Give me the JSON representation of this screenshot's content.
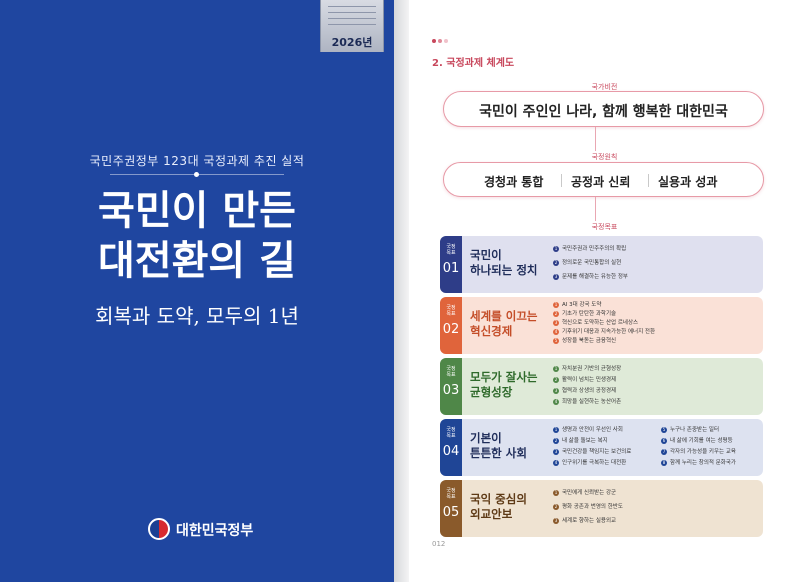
{
  "cover": {
    "year": "2026년",
    "subtitle": "국민주권정부 123대 국정과제 추진 실적",
    "title_line1": "국민이 만든",
    "title_line2": "대전환의 길",
    "tagline": "회복과 도약, 모두의 1년",
    "publisher": "대한민국정부",
    "bg_color": "#1f46a0"
  },
  "page": {
    "section_title": "2. 국정과제 체계도",
    "vision_label": "국가비전",
    "vision": "국민이 주인인 나라, 함께 행복한 대한민국",
    "principles_label": "국정원칙",
    "principles": [
      "경청과 통합",
      "공정과 신뢰",
      "실용과 성과"
    ],
    "goals_label": "국정목표",
    "goals": [
      {
        "tag": "국정\n목표",
        "num": "01",
        "title": "국민이\n하나되는 정치",
        "bg": "#dfe0ef",
        "badge": "#2e3d88",
        "items": [
          "국민주권과 민주주의의 확립",
          "정의로운 국민통합의 실현",
          "문제를 해결하는 유능한 정부"
        ]
      },
      {
        "tag": "국정\n목표",
        "num": "02",
        "title": "세계를 이끄는\n혁신경제",
        "bg": "#fae1d7",
        "badge": "#e0643b",
        "items": [
          "AI 3대 강국 도약",
          "기초가 탄탄한 과학기술",
          "혁신으로 도약하는 산업 르네상스",
          "기후위기 대응과 지속가능한 에너지 전환",
          "성장을 북돋는 금융혁신"
        ]
      },
      {
        "tag": "국정\n목표",
        "num": "03",
        "title": "모두가 잘사는\n균형성장",
        "bg": "#dfead8",
        "badge": "#4f8748",
        "items": [
          "자치분권 기반의 균형성장",
          "활력이 넘치는 민생경제",
          "협력과 상생의 공정경제",
          "희망을 실현하는 농산어촌"
        ]
      },
      {
        "tag": "국정\n목표",
        "num": "04",
        "title": "기본이\n튼튼한 사회",
        "bg": "#dde2f0",
        "badge": "#1f4596",
        "items": [
          "생명과 안전이 우선인 사회",
          "내 삶을 돌보는 복지",
          "국민건강을 책임지는 보건의료",
          "인구위기를 극복하는 대전환"
        ],
        "items2": [
          "누구나 존중받는 일터",
          "내 삶에 기회를 여는 성평등",
          "각자의 가능성을 키우는 교육",
          "함께 누리는 창의적 문화국가"
        ]
      },
      {
        "tag": "국정\n목표",
        "num": "05",
        "title": "국익 중심의\n외교안보",
        "bg": "#efe3d2",
        "badge": "#8a5a2b",
        "items": [
          "국민에게 신뢰받는 강군",
          "평화 공존과 번영의 한반도",
          "세계로 향하는 실용외교"
        ]
      }
    ],
    "page_number": "012"
  }
}
